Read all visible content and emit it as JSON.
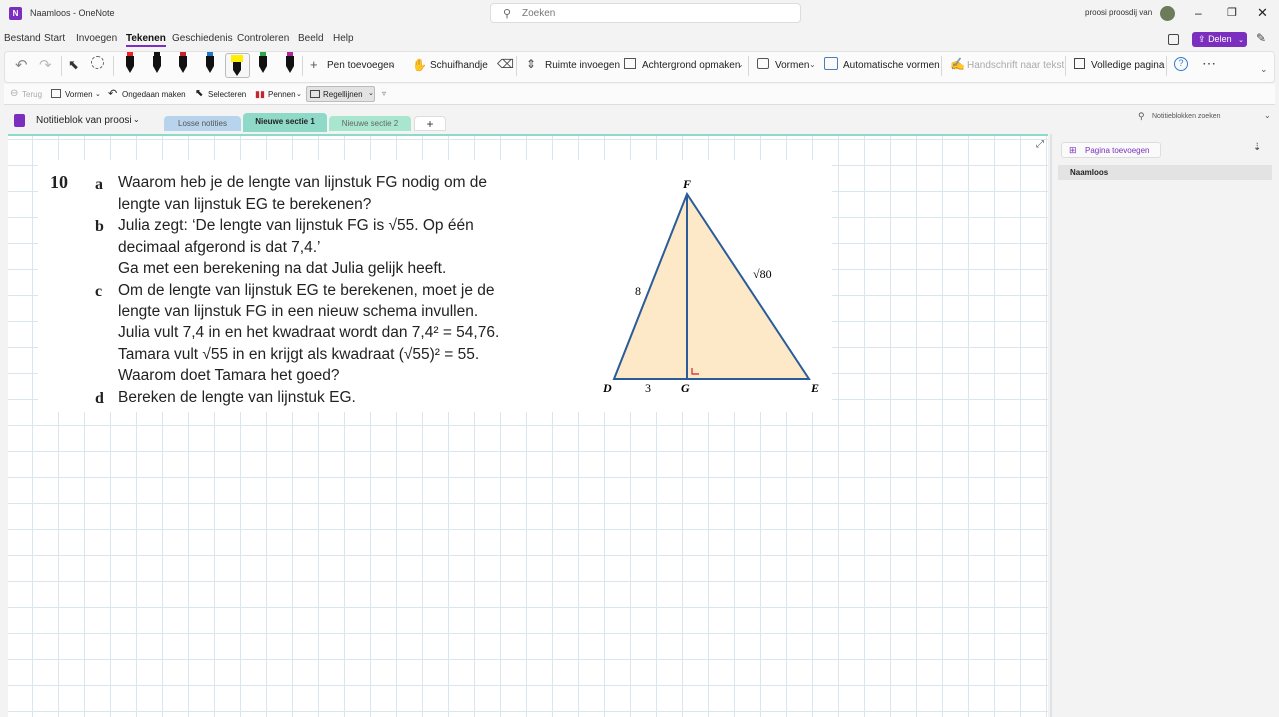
{
  "title": {
    "app": "Naamloos  -  OneNote",
    "search_placeholder": "Zoeken",
    "user": "proosi proosdij van"
  },
  "menu": [
    "Bestand",
    "Start",
    "Invoegen",
    "Tekenen",
    "Geschiedenis",
    "Controleren",
    "Beeld",
    "Help"
  ],
  "share_label": "Delen",
  "ribbon": {
    "add_pen": "Pen toevoegen",
    "hand": "Schuifhandje",
    "insert_space": "Ruimte invoegen",
    "background": "Achtergrond opmaken",
    "shapes": "Vormen",
    "auto_shapes": "Automatische vormen",
    "ink_to_text": "Handschrift naar tekst",
    "full_page": "Volledige pagina"
  },
  "ribbon2": {
    "back": "Terug",
    "shapes": "Vormen",
    "undo": "Ongedaan maken",
    "select": "Selecteren",
    "pens": "Pennen",
    "rule_lines": "Regellijnen"
  },
  "notebook": {
    "name": "Notitieblok van proosi",
    "search": "Notitieblokken zoeken"
  },
  "sections": [
    "Losse notities",
    "Nieuwe sectie 1",
    "Nieuwe sectie 2"
  ],
  "add_section": "+",
  "pages": {
    "add_page": "Pagina toevoegen",
    "items": [
      "Naamloos"
    ]
  },
  "exercise": {
    "number": "10",
    "a_letter": "a",
    "b_letter": "b",
    "c_letter": "c",
    "d_letter": "d",
    "lines": [
      "Waarom heb je de lengte van lijnstuk FG nodig om de",
      "lengte van lijnstuk EG te berekenen?",
      "Julia zegt: ‘De lengte van lijnstuk FG is √55. Op één",
      "decimaal afgerond is dat 7,4.’",
      "Ga met een berekening na dat Julia gelijk heeft.",
      "Om de lengte van lijnstuk EG te berekenen, moet je de",
      "lengte van lijnstuk FG in een nieuw schema invullen.",
      "Julia vult 7,4 in en het kwadraat wordt dan 7,4² = 54,76.",
      "Tamara vult √55 in en krijgt als kwadraat (√55)² = 55.",
      "Waarom doet Tamara het goed?",
      "Bereken de lengte van lijnstuk EG."
    ]
  },
  "figure": {
    "F": "F",
    "D": "D",
    "G": "G",
    "E": "E",
    "side_DF": "8",
    "side_DG": "3",
    "side_FE": "√80"
  }
}
